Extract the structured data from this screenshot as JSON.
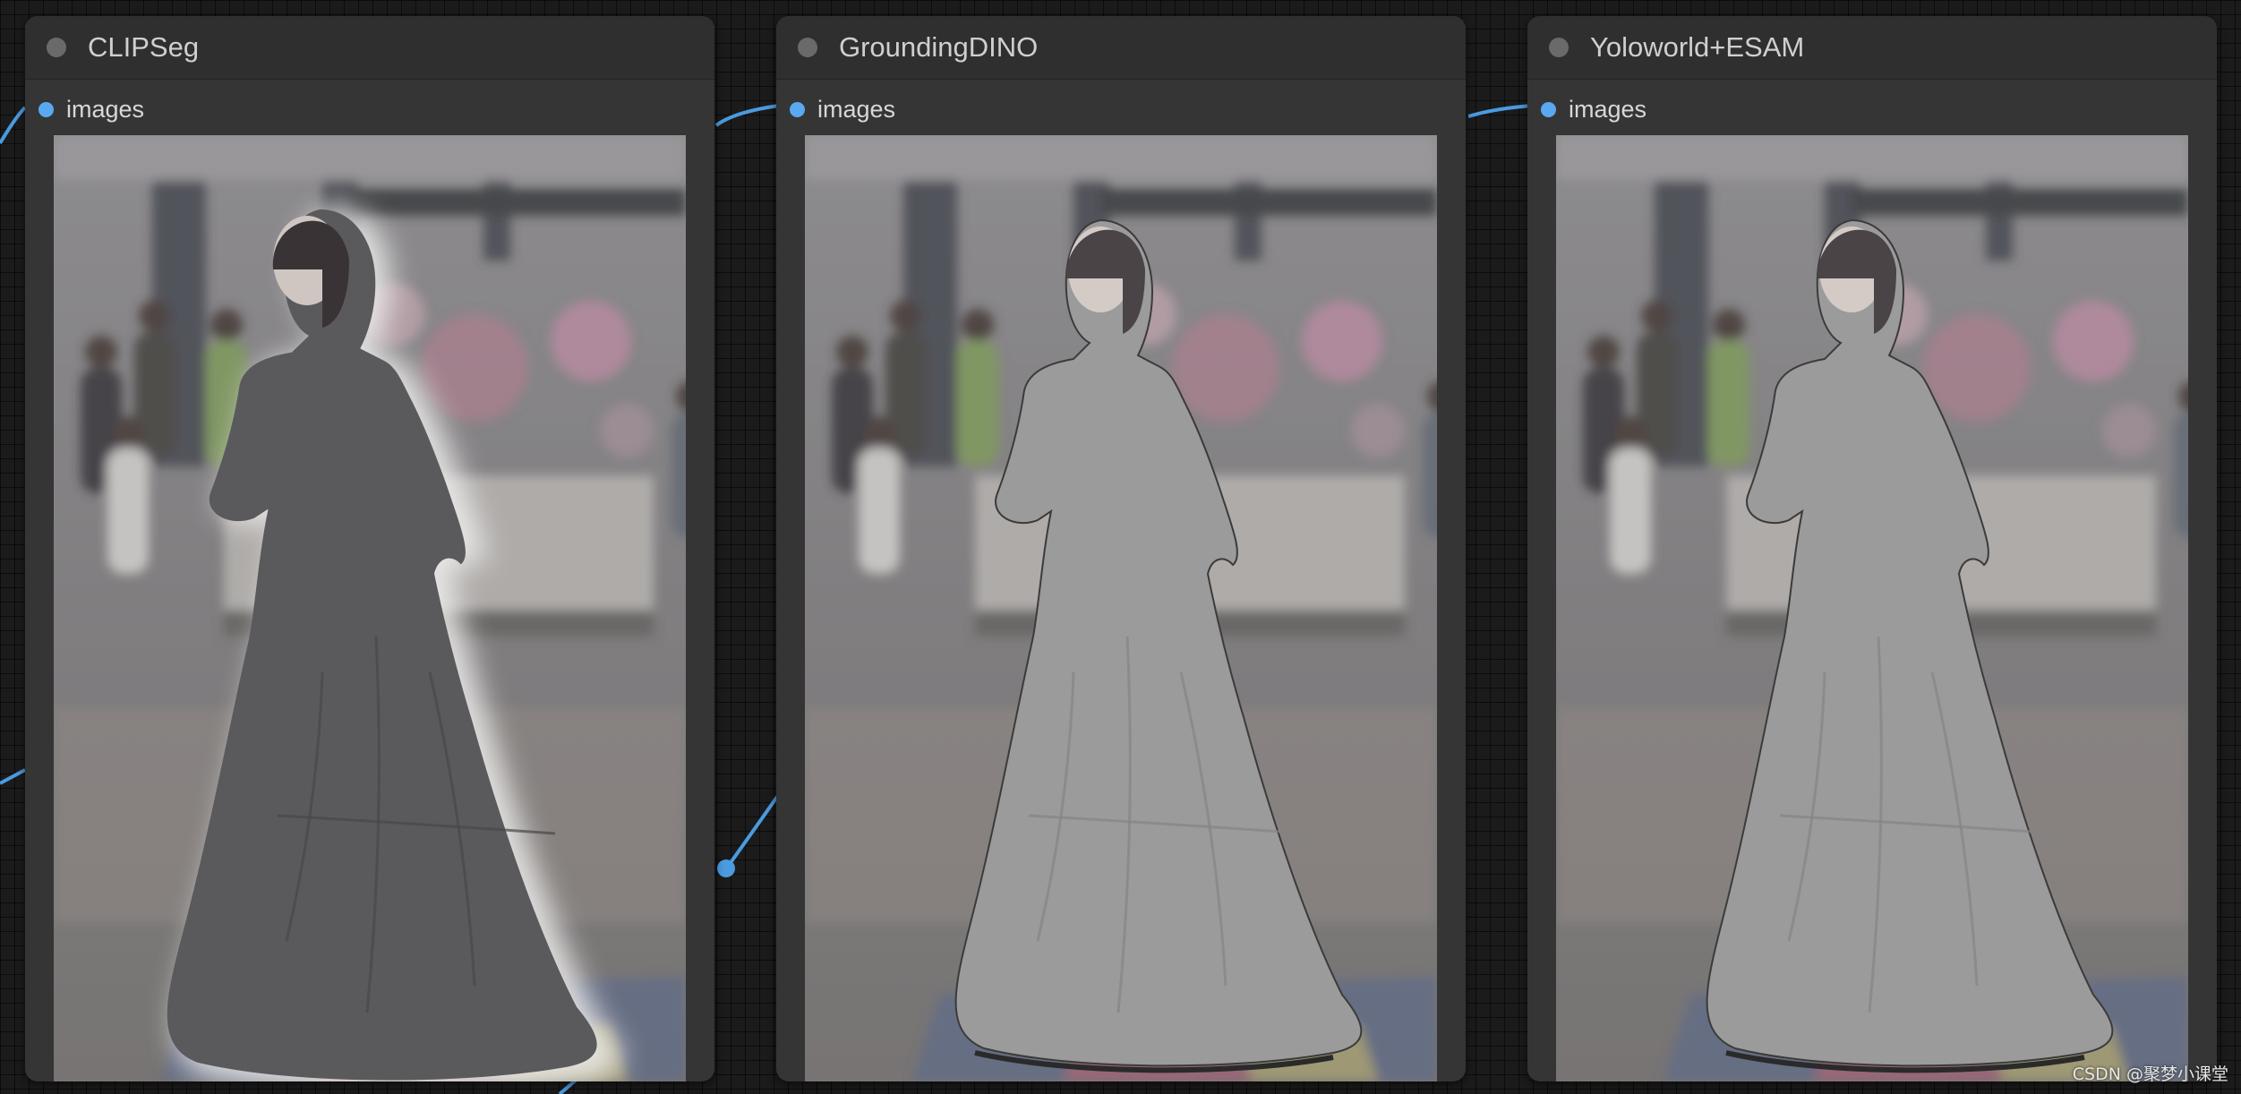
{
  "nodes": [
    {
      "title": "CLIPSeg",
      "slot_label": "images",
      "mask_style": "soft-halo"
    },
    {
      "title": "GroundingDINO",
      "slot_label": "images",
      "mask_style": "tight"
    },
    {
      "title": "Yoloworld+ESAM",
      "slot_label": "images",
      "mask_style": "tight"
    }
  ],
  "colors": {
    "slot_dot": "#5aa9f0",
    "wire": "#4a9be0",
    "node_body": "#353535",
    "node_header": "#2f2f2f",
    "canvas_bg": "#1b1b1b"
  },
  "icons": {
    "collapse": "circle-dot-icon",
    "slot": "input-slot-dot-icon"
  },
  "watermark": "CSDN @聚梦小课堂"
}
